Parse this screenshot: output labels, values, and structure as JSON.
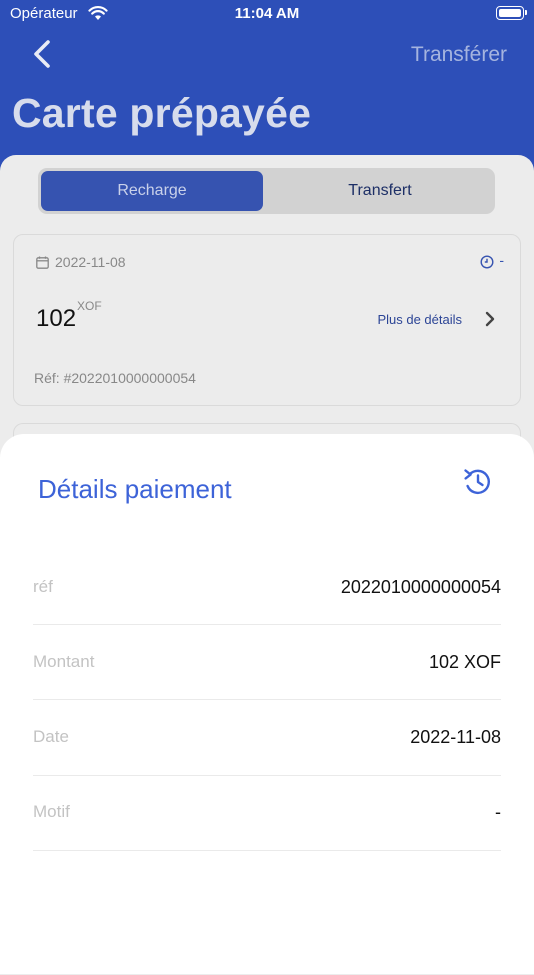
{
  "status_bar": {
    "carrier": "Opérateur",
    "time": "11:04 AM"
  },
  "header": {
    "transfer_label": "Transférer",
    "title": "Carte prépayée"
  },
  "tabs": {
    "active": "Recharge",
    "inactive": "Transfert"
  },
  "card": {
    "date": "2022-11-08",
    "status": "-",
    "amount": "102",
    "currency": "XOF",
    "more_details": "Plus de détails",
    "ref": "Réf: #2022010000000054"
  },
  "sheet": {
    "title": "Détails paiement",
    "rows": [
      {
        "label": "réf",
        "value": "2022010000000054"
      },
      {
        "label": "Montant",
        "value": "102  XOF"
      },
      {
        "label": "Date",
        "value": "2022-11-08"
      },
      {
        "label": "Motif",
        "value": "-"
      }
    ]
  },
  "colors": {
    "primary": "#2d4fb8",
    "accent": "#3d63d8"
  }
}
